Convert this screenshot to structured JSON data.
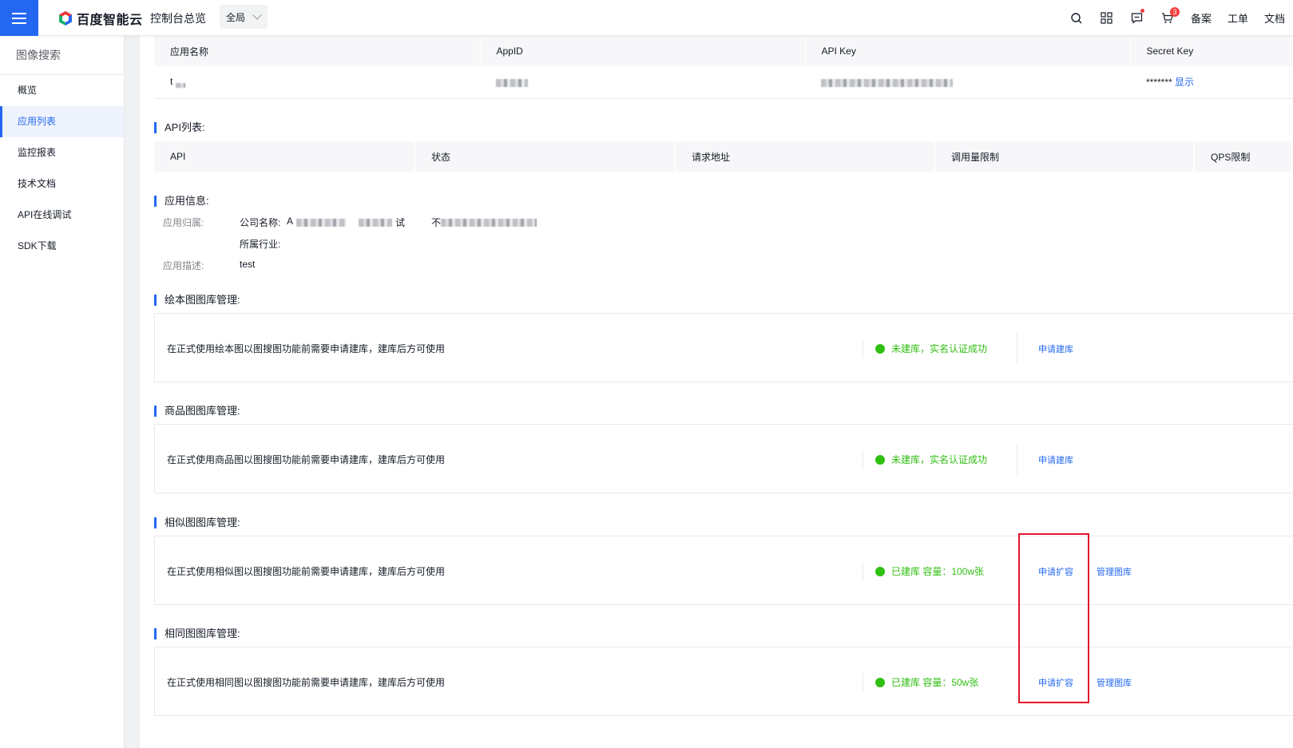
{
  "topbar": {
    "brand": "百度智能云",
    "crumb": "控制台总览",
    "scope": "全局",
    "links": [
      "备案",
      "工单",
      "文档"
    ],
    "cart_count": "3"
  },
  "sidebar": {
    "title": "图像搜索",
    "items": [
      {
        "label": "概览"
      },
      {
        "label": "应用列表"
      },
      {
        "label": "监控报表"
      },
      {
        "label": "技术文档"
      },
      {
        "label": "API在线调试"
      },
      {
        "label": "SDK下载"
      }
    ]
  },
  "app_table": {
    "headers": [
      "应用名称",
      "AppID",
      "API Key",
      "Secret Key"
    ],
    "row": {
      "name": "t",
      "secret_mask": "*******",
      "show_label": "显示"
    }
  },
  "api_section": {
    "title": "API列表:",
    "headers": [
      "API",
      "状态",
      "请求地址",
      "调用量限制",
      "QPS限制"
    ]
  },
  "app_info": {
    "title": "应用信息:",
    "owner_label": "应用归属:",
    "company_label": "公司名称:",
    "company_prefix": "A",
    "company_suffix": "试",
    "company_extra": "不",
    "industry_label": "所属行业:",
    "desc_label": "应用描述:",
    "desc_value": "test"
  },
  "libraries": [
    {
      "title": "绘本图图库管理:",
      "desc": "在正式使用绘本图以图搜图功能前需要申请建库，建库后方可使用",
      "status": "未建库，实名认证成功",
      "action1": "申请建库",
      "action2": ""
    },
    {
      "title": "商品图图库管理:",
      "desc": "在正式使用商品图以图搜图功能前需要申请建库，建库后方可使用",
      "status": "未建库，实名认证成功",
      "action1": "申请建库",
      "action2": ""
    },
    {
      "title": "相似图图库管理:",
      "desc": "在正式使用相似图以图搜图功能前需要申请建库，建库后方可使用",
      "status": "已建库 容量：100w张",
      "action1": "申请扩容",
      "action2": "管理图库"
    },
    {
      "title": "相同图图库管理:",
      "desc": "在正式使用相同图以图搜图功能前需要申请建库，建库后方可使用",
      "status": "已建库 容量：50w张",
      "action1": "申请扩容",
      "action2": "管理图库"
    }
  ],
  "colors": {
    "accent": "#2468f2",
    "success": "#30bf13",
    "highlight": "#e5142c"
  }
}
